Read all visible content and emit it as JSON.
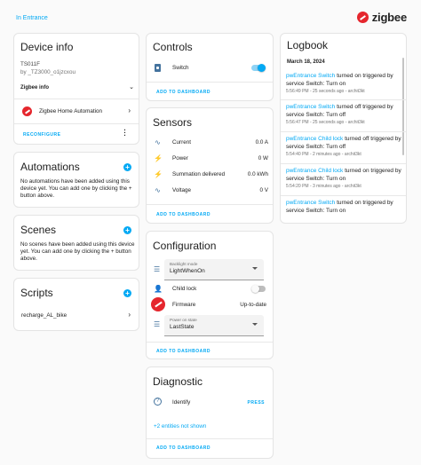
{
  "breadcrumb": "In Entrance",
  "brand": {
    "name": "zigbee"
  },
  "device_info": {
    "title": "Device info",
    "model": "TS011F",
    "manufacturer": "by _TZ3000_o1jzcxou",
    "zigbee_label": "Zigbee info",
    "integration": "Zigbee Home Automation",
    "reconfigure": "RECONFIGURE"
  },
  "automations": {
    "title": "Automations",
    "text": "No automations have been added using this device yet. You can add one by clicking the + button above."
  },
  "scenes": {
    "title": "Scenes",
    "text": "No scenes have been added using this device yet. You can add one by clicking the + button above."
  },
  "scripts": {
    "title": "Scripts",
    "items": [
      "recharge_AL_bike"
    ]
  },
  "controls": {
    "title": "Controls",
    "switch_label": "Switch",
    "switch_on": true,
    "add_to_dashboard": "ADD TO DASHBOARD"
  },
  "sensors": {
    "title": "Sensors",
    "rows": [
      {
        "label": "Current",
        "value": "0.0 A",
        "icon": "sine-wave-icon"
      },
      {
        "label": "Power",
        "value": "0 W",
        "icon": "flash-icon"
      },
      {
        "label": "Summation delivered",
        "value": "0.0 kWh",
        "icon": "flash-icon"
      },
      {
        "label": "Voltage",
        "value": "0 V",
        "icon": "sine-wave-icon"
      }
    ],
    "add_to_dashboard": "ADD TO DASHBOARD"
  },
  "configuration": {
    "title": "Configuration",
    "backlight": {
      "label": "Backlight mode",
      "value": "LightWhenOn"
    },
    "child_lock": {
      "label": "Child lock",
      "on": false
    },
    "firmware": {
      "label": "Firmware",
      "value": "Up-to-date"
    },
    "power_on": {
      "label": "Power on state",
      "value": "LastState"
    },
    "add_to_dashboard": "ADD TO DASHBOARD"
  },
  "diagnostic": {
    "title": "Diagnostic",
    "identify": "Identify",
    "press": "PRESS",
    "hidden": "+2 entities not shown",
    "add_to_dashboard": "ADD TO DASHBOARD"
  },
  "logbook": {
    "title": "Logbook",
    "date": "March 18, 2024",
    "entries": [
      {
        "entity": "pwEntrance Switch",
        "text": " turned on triggered by service Switch: Turn on",
        "meta": "5:56:49 PM - 25 seconds ago - archit3kt"
      },
      {
        "entity": "pwEntrance Switch",
        "text": " turned off triggered by service Switch: Turn off",
        "meta": "5:56:47 PM - 25 seconds ago - archit3kt"
      },
      {
        "entity": "pwEntrance Child lock",
        "text": " turned off triggered by service Switch: Turn off",
        "meta": "5:54:40 PM - 2 minutes ago - archit3kt"
      },
      {
        "entity": "pwEntrance Child lock",
        "text": " turned on triggered by service Switch: Turn on",
        "meta": "5:54:20 PM - 3 minutes ago - archit3kt"
      },
      {
        "entity": "pwEntrance Switch",
        "text": " turned on triggered by service Switch: Turn on",
        "meta": ""
      }
    ]
  },
  "colors": {
    "accent": "#03a9f4",
    "icon": "#44739e",
    "zigbee_red": "#e5262d"
  }
}
